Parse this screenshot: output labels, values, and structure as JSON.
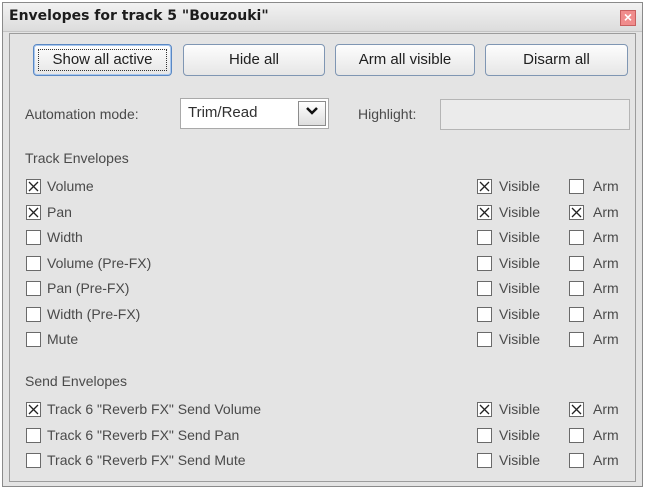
{
  "window": {
    "title": "Envelopes for track 5 \"Bouzouki\""
  },
  "buttons": {
    "show_all_active": "Show all active",
    "hide_all": "Hide all",
    "arm_all_visible": "Arm all visible",
    "disarm_all": "Disarm all"
  },
  "automation": {
    "label": "Automation mode:",
    "value": "Trim/Read"
  },
  "highlight": {
    "label": "Highlight:",
    "value": ""
  },
  "column_labels": {
    "visible": "Visible",
    "arm": "Arm"
  },
  "track_envelopes": {
    "heading": "Track Envelopes",
    "items": [
      {
        "name": "Volume",
        "active": true,
        "visible": true,
        "arm": false
      },
      {
        "name": "Pan",
        "active": true,
        "visible": true,
        "arm": true
      },
      {
        "name": "Width",
        "active": false,
        "visible": false,
        "arm": false
      },
      {
        "name": "Volume (Pre-FX)",
        "active": false,
        "visible": false,
        "arm": false
      },
      {
        "name": "Pan (Pre-FX)",
        "active": false,
        "visible": false,
        "arm": false
      },
      {
        "name": "Width (Pre-FX)",
        "active": false,
        "visible": false,
        "arm": false
      },
      {
        "name": "Mute",
        "active": false,
        "visible": false,
        "arm": false
      }
    ]
  },
  "send_envelopes": {
    "heading": "Send Envelopes",
    "items": [
      {
        "name": "Track 6 \"Reverb FX\" Send Volume",
        "active": true,
        "visible": true,
        "arm": true
      },
      {
        "name": "Track 6 \"Reverb FX\" Send Pan",
        "active": false,
        "visible": false,
        "arm": false
      },
      {
        "name": "Track 6 \"Reverb FX\" Send Mute",
        "active": false,
        "visible": false,
        "arm": false
      }
    ]
  }
}
